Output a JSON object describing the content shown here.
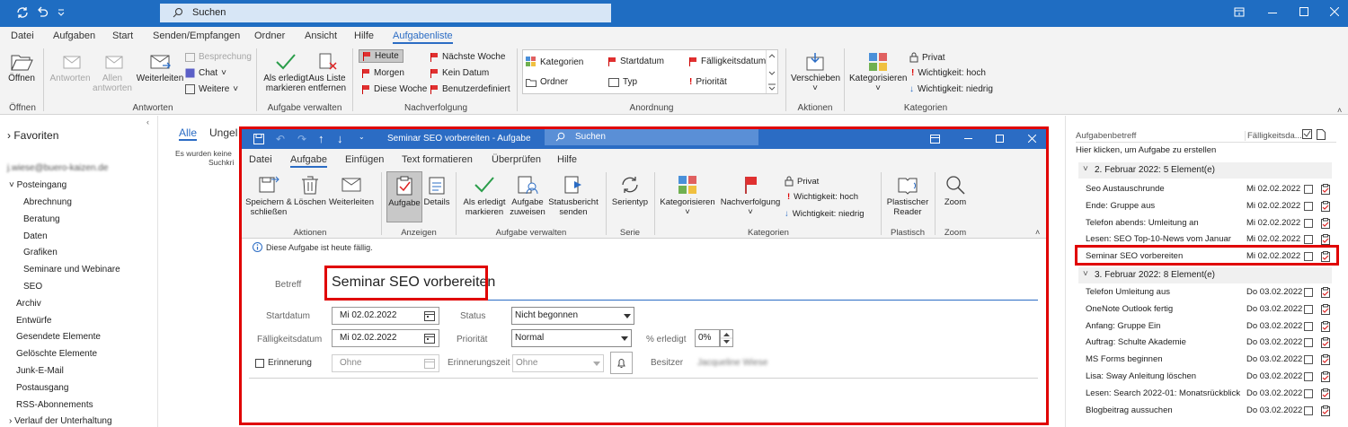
{
  "app": {
    "search_placeholder": "Suchen"
  },
  "menu": [
    "Datei",
    "Aufgaben",
    "Start",
    "Senden/Empfangen",
    "Ordner",
    "Ansicht",
    "Hilfe",
    "Aufgabenliste"
  ],
  "ribbon": {
    "open": "Öffnen",
    "answer": "Antworten",
    "answer_all": "Allen antworten",
    "forward": "Weiterleiten",
    "meeting": "Besprechung",
    "chat": "Chat",
    "more": "Weitere",
    "mark_done": "Als erledigt markieren",
    "remove_list": "Aus Liste entfernen",
    "today": "Heute",
    "tomorrow": "Morgen",
    "this_week": "Diese Woche",
    "next_week": "Nächste Woche",
    "no_date": "Kein Datum",
    "custom": "Benutzerdefiniert",
    "categories": "Kategorien",
    "startdate": "Startdatum",
    "duedate": "Fälligkeitsdatum",
    "folder": "Ordner",
    "type": "Typ",
    "priority": "Priorität",
    "move": "Verschieben",
    "categorize": "Kategorisieren",
    "private": "Privat",
    "high": "Wichtigkeit: hoch",
    "low": "Wichtigkeit: niedrig",
    "groups": {
      "open": "Öffnen",
      "answers": "Antworten",
      "manage": "Aufgabe verwalten",
      "followup": "Nachverfolgung",
      "arrange": "Anordnung",
      "actions": "Aktionen",
      "categories": "Kategorien"
    }
  },
  "leftnav": {
    "favorites": "Favoriten",
    "account": "j.wiese@buero-kaizen.de",
    "inbox": "Posteingang",
    "subfolders": [
      "Abrechnung",
      "Beratung",
      "Daten",
      "Grafiken",
      "Seminare und Webinare",
      "SEO"
    ],
    "folders": [
      "Archiv",
      "Entwürfe",
      "Gesendete Elemente",
      "Gelöschte Elemente",
      "Junk-E-Mail",
      "Postausgang",
      "RSS-Abonnements"
    ],
    "history": "Verlauf der Unterhaltung"
  },
  "midpane": {
    "tab_all": "Alle",
    "tab_open": "Ungel",
    "empty_line1": "Es wurden keine",
    "empty_line2": "Suchkri"
  },
  "dialog": {
    "title": "Seminar SEO vorbereiten  -  Aufgabe",
    "search": "Suchen",
    "menu": [
      "Datei",
      "Aufgabe",
      "Einfügen",
      "Text formatieren",
      "Überprüfen",
      "Hilfe"
    ],
    "ribbon": {
      "save": "Speichern & schließen",
      "delete": "Löschen",
      "forward": "Weiterleiten",
      "task": "Aufgabe",
      "details": "Details",
      "mark_done": "Als erledigt markieren",
      "assign": "Aufgabe zuweisen",
      "status_report": "Statusbericht senden",
      "series": "Serientyp",
      "categorize": "Kategorisieren",
      "followup": "Nachverfolgung",
      "private": "Privat",
      "high": "Wichtigkeit: hoch",
      "low": "Wichtigkeit: niedrig",
      "reader": "Plastischer Reader",
      "zoom": "Zoom",
      "groups": {
        "actions": "Aktionen",
        "views": "Anzeigen",
        "manage": "Aufgabe verwalten",
        "series": "Serie",
        "categories": "Kategorien",
        "immersive": "Plastisch",
        "zoom": "Zoom"
      }
    },
    "info": "Diese Aufgabe ist heute fällig.",
    "subject_label": "Betreff",
    "subject": "Seminar SEO vorbereiten",
    "start_label": "Startdatum",
    "start": "Mi 02.02.2022",
    "due_label": "Fälligkeitsdatum",
    "due": "Mi 02.02.2022",
    "status_label": "Status",
    "status": "Nicht begonnen",
    "priority_label": "Priorität",
    "priority": "Normal",
    "done_label": "% erledigt",
    "done": "0%",
    "reminder_label": "Erinnerung",
    "reminder": "Ohne",
    "reminder_time_label": "Erinnerungszeit",
    "reminder_time": "Ohne",
    "owner_label": "Besitzer",
    "owner": "Jacqueline Wiese"
  },
  "tasks": {
    "col_subject": "Aufgabenbetreff",
    "col_due": "Fälligkeitsda...",
    "new_prompt": "Hier klicken, um Aufgabe zu erstellen",
    "groups": [
      {
        "title": "2. Februar 2022: 5 Element(e)",
        "items": [
          {
            "s": "Seo Austauschrunde",
            "d": "Mi 02.02.2022"
          },
          {
            "s": "Ende: Gruppe aus",
            "d": "Mi 02.02.2022"
          },
          {
            "s": "Telefon abends: Umleitung an",
            "d": "Mi 02.02.2022"
          },
          {
            "s": "Lesen: SEO Top-10-News vom Januar",
            "d": "Mi 02.02.2022"
          },
          {
            "s": "Seminar SEO vorbereiten",
            "d": "Mi 02.02.2022"
          }
        ]
      },
      {
        "title": "3. Februar 2022: 8 Element(e)",
        "items": [
          {
            "s": "Telefon Umleitung aus",
            "d": "Do 03.02.2022"
          },
          {
            "s": "OneNote Outlook fertig",
            "d": "Do 03.02.2022"
          },
          {
            "s": "Anfang: Gruppe Ein",
            "d": "Do 03.02.2022"
          },
          {
            "s": "Auftrag: Schulte Akademie",
            "d": "Do 03.02.2022"
          },
          {
            "s": "MS Forms beginnen",
            "d": "Do 03.02.2022"
          },
          {
            "s": "Lisa: Sway Anleitung löschen",
            "d": "Do 03.02.2022"
          },
          {
            "s": "Lesen: Search 2022-01: Monatsrückblick",
            "d": "Do 03.02.2022"
          },
          {
            "s": "Blogbeitrag aussuchen",
            "d": "Do 03.02.2022"
          }
        ]
      }
    ]
  },
  "colors": {
    "accent": "#2b6cc4",
    "titlebar": "#1f6dc2",
    "highlight": "#e00000",
    "flag": "#e03030"
  }
}
